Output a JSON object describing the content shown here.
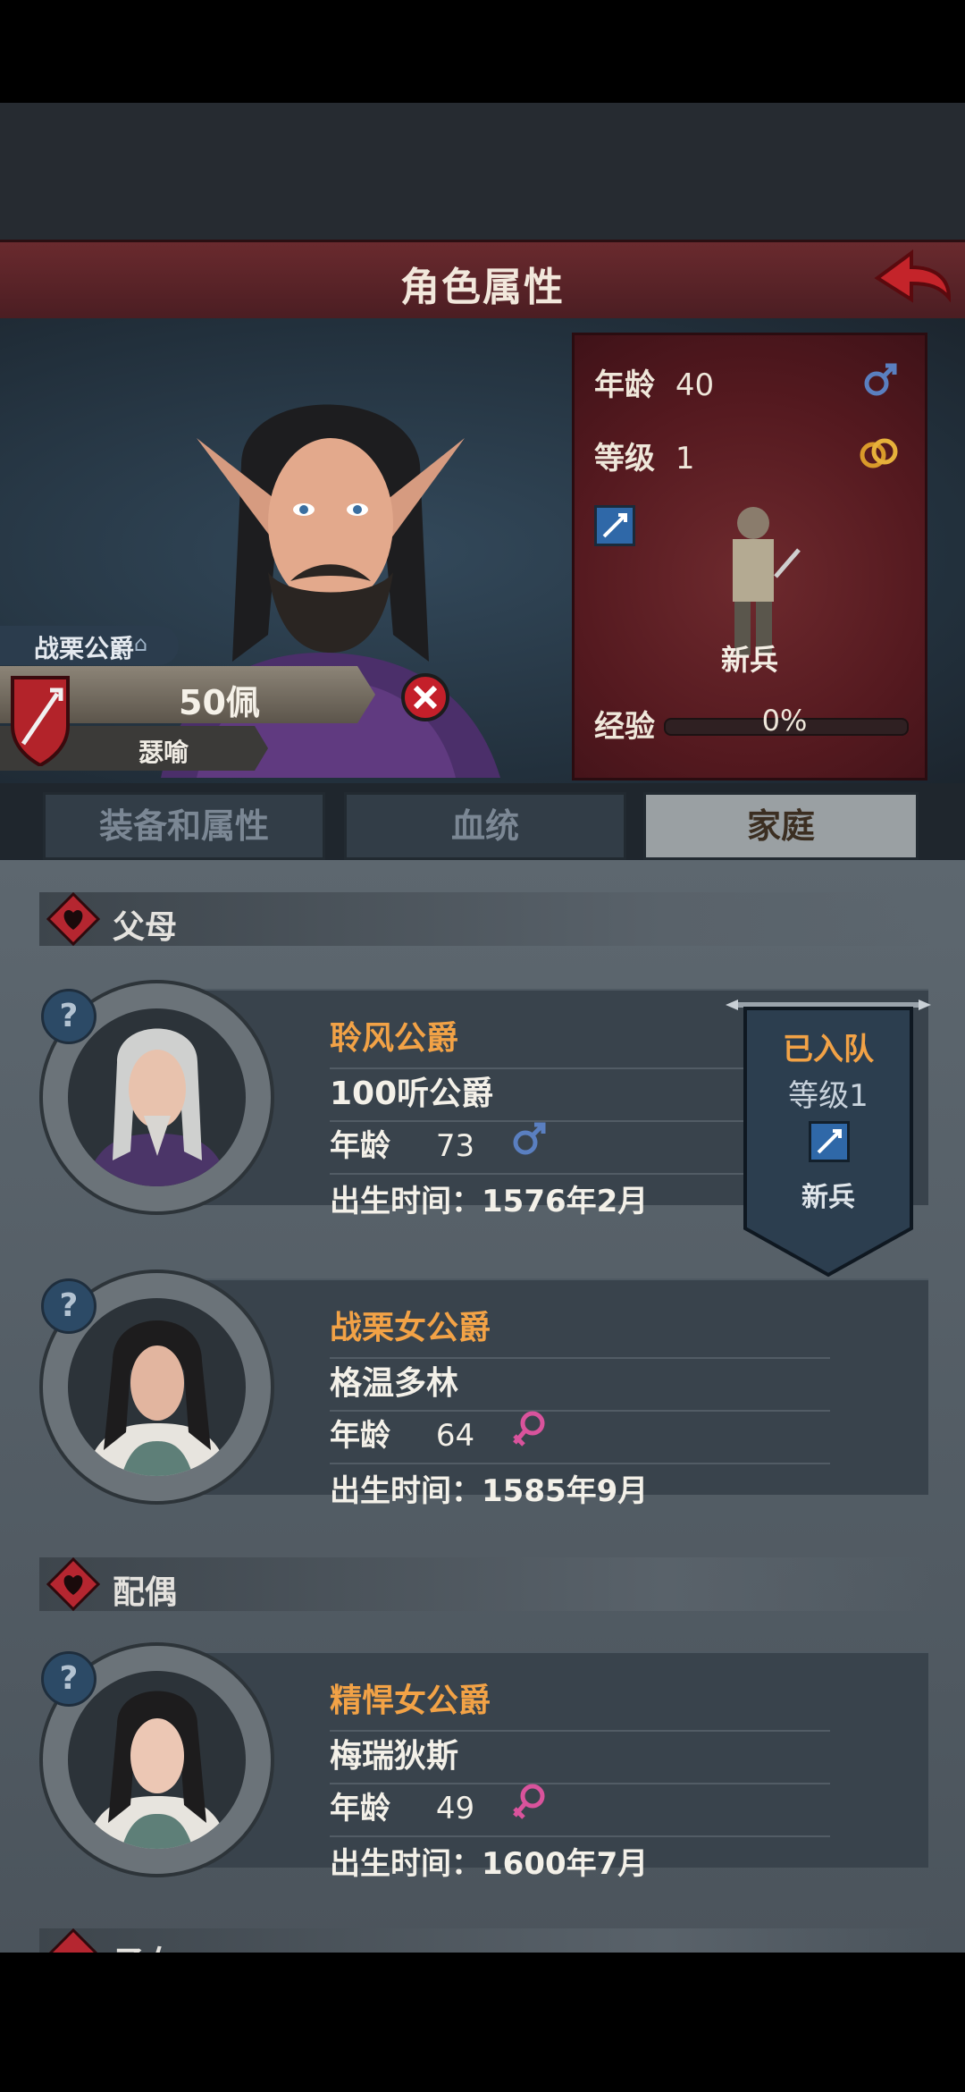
{
  "header": {
    "title": "角色属性"
  },
  "character": {
    "title_name": "战栗公爵",
    "gold": "50佩",
    "name": "瑟喻"
  },
  "stats": {
    "age_label": "年龄",
    "age_value": "40",
    "level_label": "等级",
    "level_value": "1",
    "unit_class": "新兵",
    "xp_label": "经验",
    "xp_value": "0%"
  },
  "tabs": [
    {
      "label": "装备和属性"
    },
    {
      "label": "血统"
    },
    {
      "label": "家庭"
    }
  ],
  "sections": {
    "parents": "父母",
    "spouse": "配偶",
    "children_partial": "子女"
  },
  "members": [
    {
      "title": "聆风公爵",
      "name": "100听公爵",
      "age_label": "年龄",
      "age": "73",
      "birth": "出生时间：1576年2月",
      "gender": "male"
    },
    {
      "title": "战栗女公爵",
      "name": "格温多林",
      "age_label": "年龄",
      "age": "64",
      "birth": "出生时间：1585年9月",
      "gender": "female"
    },
    {
      "title": "精悍女公爵",
      "name": "梅瑞狄斯",
      "age_label": "年龄",
      "age": "49",
      "birth": "出生时间：1600年7月",
      "gender": "female"
    }
  ],
  "pennant": {
    "status": "已入队",
    "level": "等级1",
    "unit": "新兵"
  },
  "colors": {
    "accent_orange": "#f2a246",
    "male_blue": "#5a7fc0",
    "female_pink": "#d9539c",
    "header_red": "#6a2a2e"
  }
}
